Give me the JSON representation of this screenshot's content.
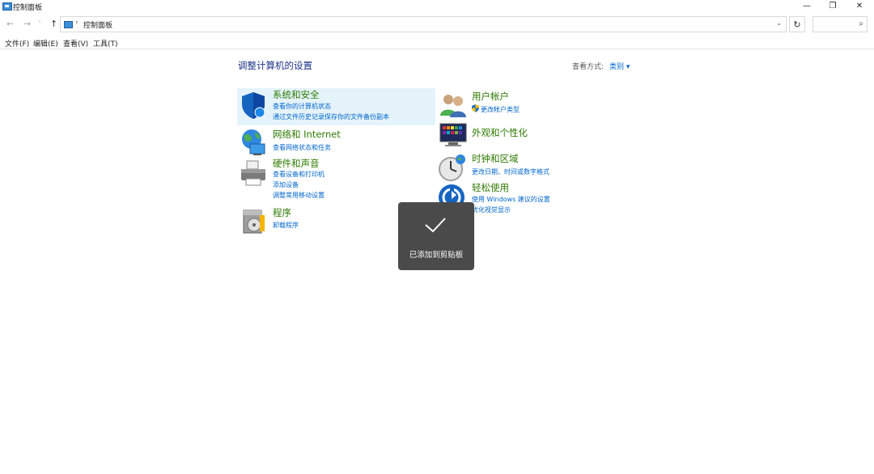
{
  "window": {
    "title": "控制面板",
    "min_glyph": "—",
    "max_glyph": "❐",
    "close_glyph": "✕"
  },
  "address": {
    "back_glyph": "←",
    "forward_glyph": "→",
    "recent_glyph": "˅",
    "up_glyph": "↑",
    "separator": "›",
    "path": "控制面板",
    "dropdown_glyph": "⌄",
    "refresh_glyph": "↻",
    "search_placeholder": "",
    "search_glyph": "⌕"
  },
  "menu": {
    "items": [
      "文件(F)",
      "编辑(E)",
      "查看(V)",
      "工具(T)"
    ]
  },
  "content": {
    "heading": "调整计算机的设置",
    "view_by_label": "查看方式:",
    "view_by_value": "类别 ▾"
  },
  "categories": {
    "system": {
      "title": "系统和安全",
      "links": [
        "查看你的计算机状态",
        "通过文件历史记录保存你的文件备份副本"
      ],
      "icon": "shield-icon"
    },
    "network": {
      "title": "网络和 Internet",
      "links": [
        "查看网络状态和任务"
      ],
      "icon": "network-globe-icon"
    },
    "hardware": {
      "title": "硬件和声音",
      "links": [
        "查看设备和打印机",
        "添加设备",
        "调整常用移动设置"
      ],
      "icon": "printer-icon"
    },
    "programs": {
      "title": "程序",
      "links": [
        "卸载程序"
      ],
      "icon": "programs-disc-icon"
    },
    "user": {
      "title": "用户帐户",
      "links": [
        "更改帐户类型"
      ],
      "icon": "users-icon"
    },
    "appearance": {
      "title": "外观和个性化",
      "links": [],
      "icon": "monitor-colors-icon"
    },
    "clock": {
      "title": "时钟和区域",
      "links": [
        "更改日期、时间或数字格式"
      ],
      "icon": "clock-icon"
    },
    "ease": {
      "title": "轻松使用",
      "links": [
        "使用 Windows 建议的设置",
        "优化视觉显示"
      ],
      "icon": "accessibility-icon"
    }
  },
  "toast": {
    "text": "已添加到剪贴板",
    "icon": "checkmark-icon"
  },
  "colors": {
    "heading": "#1e3287",
    "category_title": "#2d7a00",
    "link": "#0066cc",
    "highlight": "#e5f3fb",
    "toast_bg": "#4a4a4a"
  }
}
